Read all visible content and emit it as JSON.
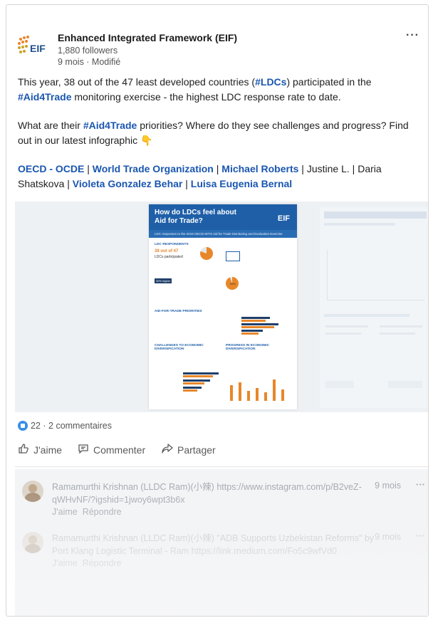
{
  "post": {
    "author": "Enhanced Integrated Framework (EIF)",
    "followers": "1,880 followers",
    "meta": "9 mois · Modifié",
    "logo_text": "EIF",
    "more_label": "···",
    "para1_a": "This year, 38 out of the 47 least developed countries (",
    "para1_tag1": "#LDCs",
    "para1_b": ") participated in the ",
    "para1_tag2": "#Aid4Trade",
    "para1_c": " monitoring exercise - the highest LDC response rate to date.",
    "para2_a": "What are their ",
    "para2_tag": "#Aid4Trade",
    "para2_b": " priorities? Where do they see challenges and progress? Find out in our latest infographic 👇",
    "mentions": {
      "m1": "OECD - OCDE",
      "m2": "World Trade Organization",
      "m3": "Michael Roberts",
      "m4": "Justine L.",
      "m5": "Daria Shatskova",
      "m6": "Violeta Gonzalez Behar",
      "m7": "Luisa Eugenia Bernal",
      "separator": " | "
    }
  },
  "infographic": {
    "title": "How do LDCs feel about Aid for Trade?",
    "eif": "EIF",
    "subtitle": "LDC responses to the 2019 OECD-WTO Aid for Trade Monitoring and Evaluation Exercise",
    "sec1": "LDC RESPONDENTS",
    "stat1": "38 out of 47",
    "stat1b": "LDCs participated",
    "stat2": "30% higher",
    "sec2": "AID-FOR-TRADE PRIORITIES",
    "sec3": "CHALLENGES TO ECONOMIC DIVERSIFICATION",
    "sec4": "PROGRESS IN ECONOMIC DIVERSIFICATION",
    "pct": "95%"
  },
  "stats": {
    "reactions": "22",
    "comments": "2 commentaires",
    "dot": " · "
  },
  "actions": {
    "like": "J'aime",
    "comment": "Commenter",
    "share": "Partager"
  },
  "comments": [
    {
      "author": "Ramamurthi Krishnan (LLDC Ram)(小辣)",
      "text": "https://www.instagram.com/p/B2veZ-qWHvNF/?igshid=1jwoy6wpt3b6x",
      "time": "9 mois",
      "like": "J'aime",
      "reply": "Répondre"
    },
    {
      "author": "Ramamurthi Krishnan (LLDC Ram)(小辣)",
      "text": "\"ADB Supports Uzbekistan Reforms\" by Port Klang Logistic Terminal - Ram https://link.medium.com/Fo5c9wfVd0",
      "time": "9 mois",
      "like": "J'aime",
      "reply": "Répondre"
    }
  ]
}
